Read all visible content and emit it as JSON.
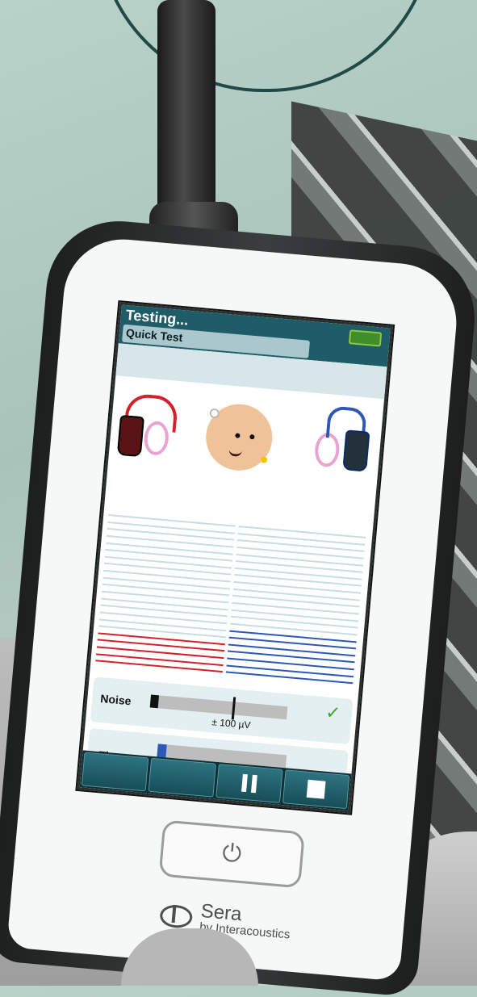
{
  "screen": {
    "title": "Testing...",
    "subtitle": "Quick Test",
    "battery_color": "#8ec63f"
  },
  "measurement": {
    "left_color": "#d3202a",
    "right_color": "#2d58b8",
    "left_bars_filled": 5,
    "right_bars_filled": 7,
    "total_bars": 22
  },
  "noise": {
    "label": "Noise",
    "value": "± 100 µV",
    "level": 0.06,
    "threshold": 0.6,
    "status_icon": "check-icon"
  },
  "time": {
    "label": "Time",
    "progress": 0.07
  },
  "controls": {
    "buttons": [
      "",
      "",
      "pause-icon",
      "stop-icon"
    ]
  },
  "brand": {
    "name": "Sera",
    "tagline": "by Interacoustics"
  }
}
